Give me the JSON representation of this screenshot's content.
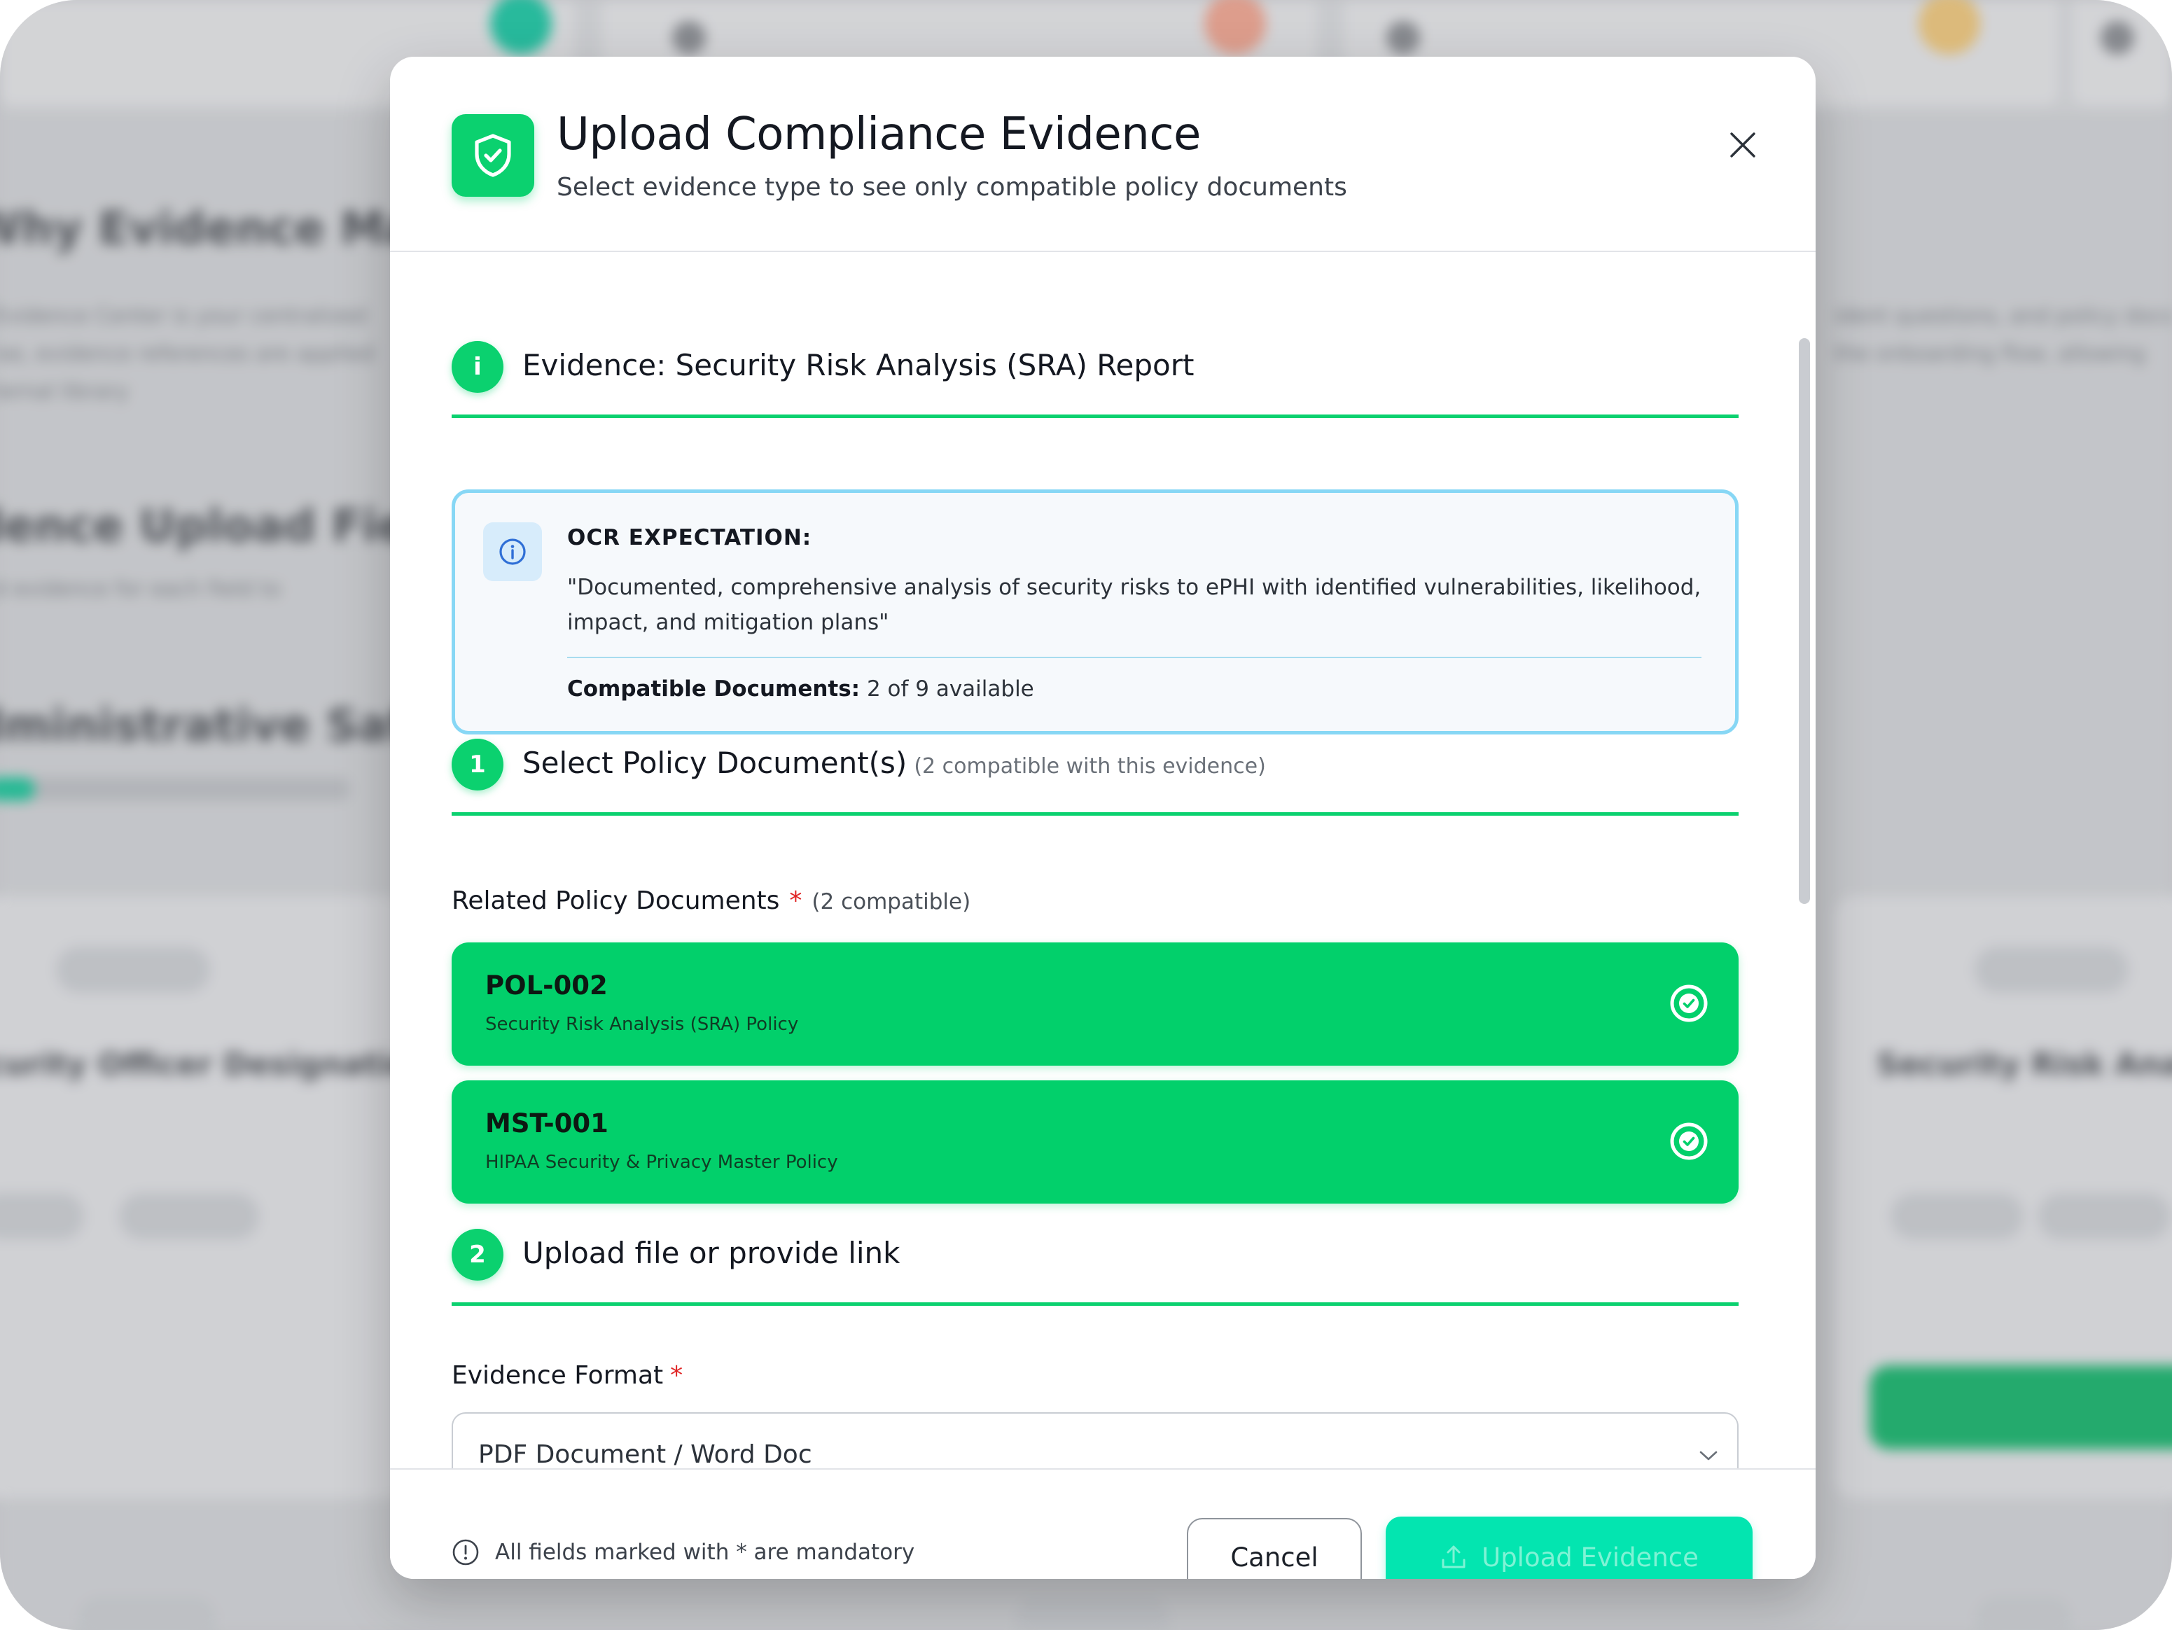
{
  "modal": {
    "title": "Upload Compliance Evidence",
    "subtitle": "Select evidence type to see only compatible policy documents",
    "icon": "shield-check-icon",
    "close_icon": "close-icon"
  },
  "evidence": {
    "badge": "i",
    "title": "Evidence: Security Risk Analysis (SRA) Report"
  },
  "ocr": {
    "label": "OCR EXPECTATION:",
    "text": "\"Documented, comprehensive analysis of security risks to ePHI with identified vulnerabilities, likelihood, impact, and mitigation plans\"",
    "compat_label": "Compatible Documents:",
    "compat_value": "2 of 9 available"
  },
  "step1": {
    "number": "1",
    "title": "Select Policy Document(s)",
    "note": "(2 compatible with this evidence)"
  },
  "policies": {
    "label": "Related Policy Documents",
    "required": "*",
    "note": "(2 compatible)",
    "items": [
      {
        "code": "POL-002",
        "name": "Security Risk Analysis (SRA) Policy",
        "selected": true
      },
      {
        "code": "MST-001",
        "name": "HIPAA Security & Privacy Master Policy",
        "selected": true
      }
    ]
  },
  "step2": {
    "number": "2",
    "title": "Upload file or provide link"
  },
  "format": {
    "label": "Evidence Format",
    "required": "*",
    "value": "PDF Document / Word Doc"
  },
  "footer": {
    "note": "All fields marked with * are mandatory",
    "cancel": "Cancel",
    "upload": "Upload Evidence"
  },
  "colors": {
    "accent_green": "#0bd16f",
    "card_green": "#02d06b",
    "upload_teal": "#03e5b0",
    "info_border": "#87d7f5"
  }
}
